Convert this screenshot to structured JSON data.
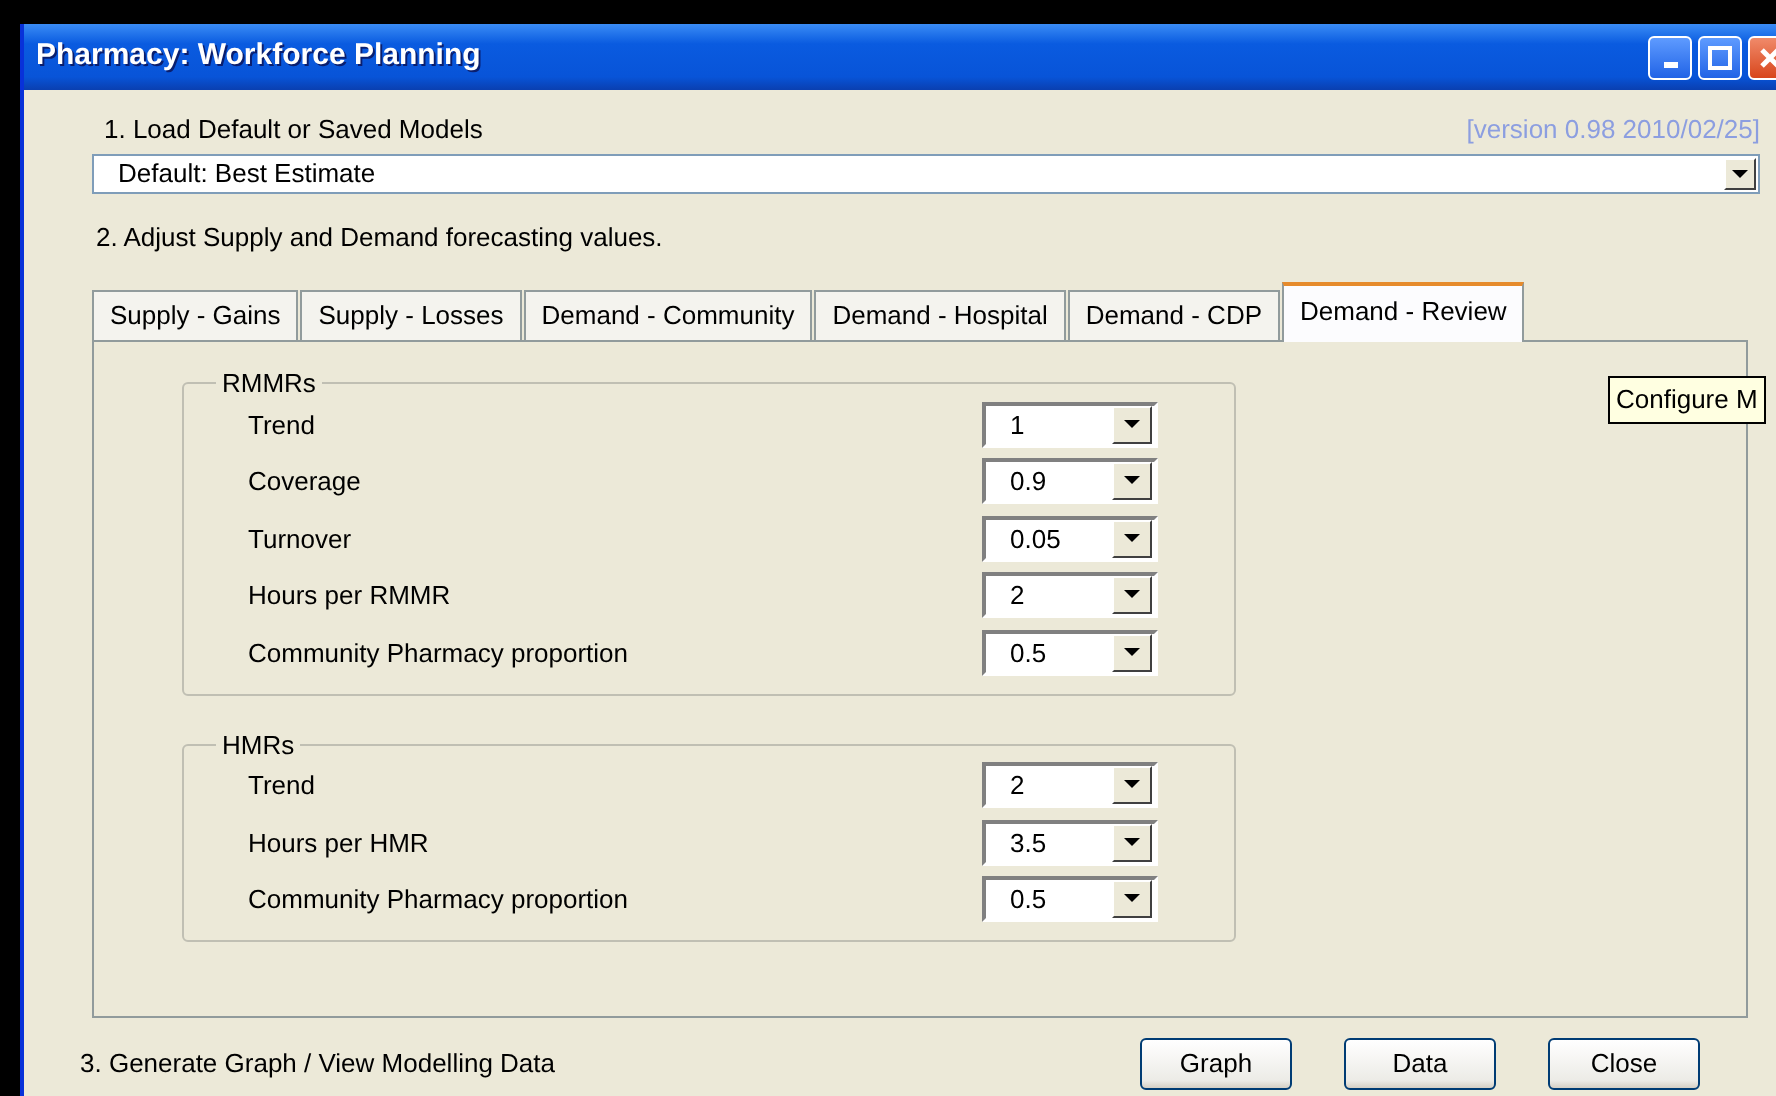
{
  "window": {
    "title": "Pharmacy: Workforce Planning"
  },
  "step_1": {
    "label": "1. Load Default or Saved Models",
    "version": "[version 0.98 2010/02/25]",
    "model_select": {
      "value": "Default: Best Estimate"
    }
  },
  "step_2": {
    "label": "2. Adjust Supply and Demand forecasting values."
  },
  "tabs": [
    {
      "label": "Supply - Gains",
      "selected": false
    },
    {
      "label": "Supply - Losses",
      "selected": false
    },
    {
      "label": "Demand - Community",
      "selected": false
    },
    {
      "label": "Demand - Hospital",
      "selected": false
    },
    {
      "label": "Demand - CDP",
      "selected": false
    },
    {
      "label": "Demand - Review",
      "selected": true
    }
  ],
  "groups": [
    {
      "title": "RMMRs",
      "rows": [
        {
          "label": "Trend",
          "value": "1"
        },
        {
          "label": "Coverage",
          "value": "0.9"
        },
        {
          "label": "Turnover",
          "value": "0.05"
        },
        {
          "label": "Hours per RMMR",
          "value": "2"
        },
        {
          "label": "Community Pharmacy proportion",
          "value": "0.5"
        }
      ]
    },
    {
      "title": "HMRs",
      "rows": [
        {
          "label": "Trend",
          "value": "2"
        },
        {
          "label": "Hours per HMR",
          "value": "3.5"
        },
        {
          "label": "Community Pharmacy proportion",
          "value": "0.5"
        }
      ]
    }
  ],
  "tooltip": {
    "text": "Configure M"
  },
  "step_3": {
    "label": "3. Generate Graph / View Modelling Data"
  },
  "buttons": [
    "Graph",
    "Data",
    "Close"
  ]
}
